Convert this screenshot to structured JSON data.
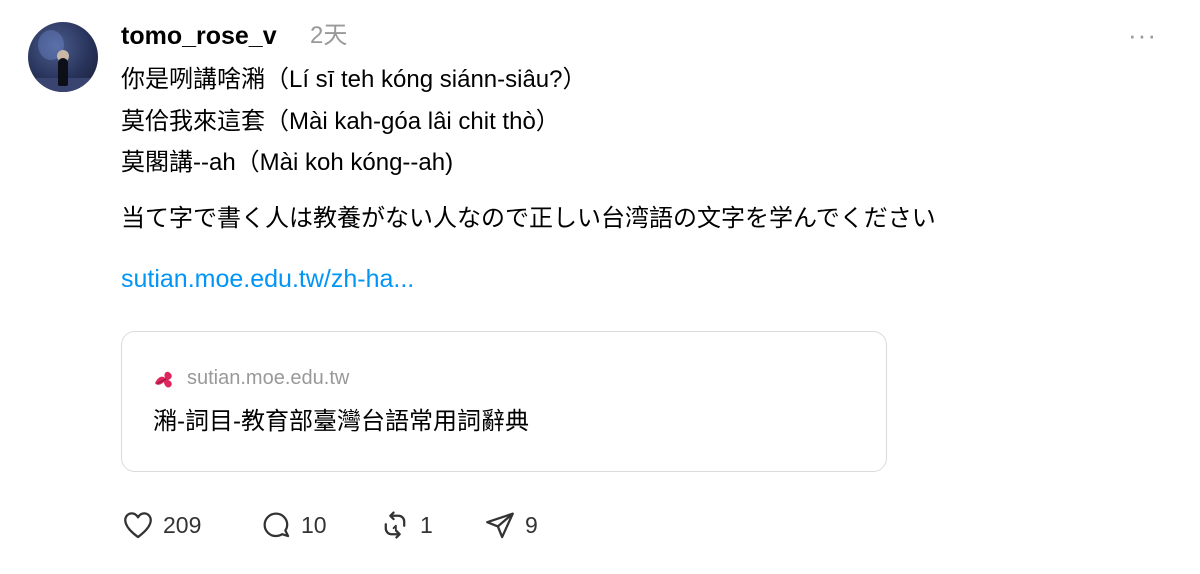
{
  "post": {
    "username": "tomo_rose_v",
    "timestamp": "2天",
    "more_label": "···",
    "lines": [
      "你是咧講啥潲（Lí sī teh kóng siánn-siâu?）",
      "莫佮我來這套（Mài kah-góa lâi chit thò）",
      "莫閣講--ah（Mài koh kóng--ah)",
      "当て字で書く人は教養がない人なので正しい台湾語の文字を学んでください"
    ],
    "link_text": "sutian.moe.edu.tw/zh-ha...",
    "card": {
      "domain": "sutian.moe.edu.tw",
      "title": "潲-詞目-教育部臺灣台語常用詞辭典",
      "favicon": "flower-favicon-icon",
      "favicon_color": "#e0245e"
    },
    "actions": {
      "likes": "209",
      "comments": "10",
      "reposts": "1",
      "shares": "9"
    },
    "colors": {
      "link": "#0095f6",
      "muted": "#999999",
      "border": "#dbdbdb"
    }
  }
}
